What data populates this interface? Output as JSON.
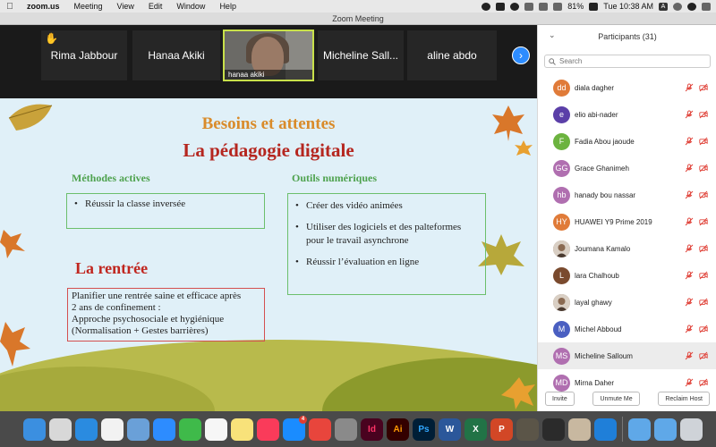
{
  "menubar": {
    "app": "zoom.us",
    "items": [
      "Meeting",
      "View",
      "Edit",
      "Window",
      "Help"
    ],
    "battery": "81%",
    "clock": "Tue 10:38 AM",
    "input_lang": "A"
  },
  "window": {
    "title": "Zoom Meeting"
  },
  "strip": {
    "tiles": [
      {
        "name": "Rima Jabbour",
        "hand_raised": true
      },
      {
        "name": "Hanaa Akiki"
      },
      {
        "name": "hanaa akiki",
        "video": true
      },
      {
        "name": "Micheline Sall..."
      },
      {
        "name": "aline abdo"
      }
    ]
  },
  "slide": {
    "title1": "Besoins et attentes",
    "title2": "La pédagogie digitale",
    "left_heading": "Méthodes actives",
    "left_items": [
      "Réussir la classe inversée"
    ],
    "right_heading": "Outils numériques",
    "right_items": [
      "Créer des vidéo animées",
      "Utiliser des logiciels et des palteformes pour le travail asynchrone",
      "Réussir l’évaluation en ligne"
    ],
    "rentree_title": "La rentrée",
    "rentree_lines": [
      "Planifier une rentrée saine  et efficace après",
      "2 ans de confinement :",
      "Approche psychosociale et hygiénique",
      "(Normalisation + Gestes barrières)"
    ]
  },
  "participants": {
    "header": "Participants (31)",
    "search_placeholder": "Search",
    "list": [
      {
        "initials": "dd",
        "name": "diala dagher",
        "color": "#e07b39"
      },
      {
        "initials": "e",
        "name": "elio abi-nader",
        "color": "#5b3fa8"
      },
      {
        "initials": "F",
        "name": "Fadia Abou jaoude",
        "color": "#6cb33f"
      },
      {
        "initials": "GG",
        "name": "Grace Ghanimeh",
        "color": "#b06fb0"
      },
      {
        "initials": "hb",
        "name": "hanady bou nassar",
        "color": "#b06fb0"
      },
      {
        "initials": "HY",
        "name": "HUAWEI Y9 Prime 2019",
        "color": "#e07b39"
      },
      {
        "initials": "",
        "name": "Joumana Kamalo",
        "photo": true
      },
      {
        "initials": "L",
        "name": "lara Chalhoub",
        "color": "#7a4a2e"
      },
      {
        "initials": "",
        "name": "layal ghawy",
        "photo": true
      },
      {
        "initials": "M",
        "name": "Michel Abboud",
        "color": "#4a5fc1"
      },
      {
        "initials": "MS",
        "name": "Micheline Salloum",
        "color": "#b06fb0"
      },
      {
        "initials": "MD",
        "name": "Mirna Daher",
        "color": "#b06fb0"
      }
    ],
    "buttons": {
      "invite": "Invite",
      "unmute": "Unmute Me",
      "reclaim": "Reclaim Host"
    }
  },
  "dock": {
    "apps": [
      {
        "name": "finder",
        "color": "#3b8fe0",
        "glyph": ""
      },
      {
        "name": "launchpad",
        "color": "#d8d8d8",
        "glyph": ""
      },
      {
        "name": "safari",
        "color": "#2a8be0",
        "glyph": ""
      },
      {
        "name": "chrome",
        "color": "#f2f2f2",
        "glyph": ""
      },
      {
        "name": "preview",
        "color": "#6aa0d8",
        "glyph": ""
      },
      {
        "name": "zoom",
        "color": "#2d8cff",
        "glyph": ""
      },
      {
        "name": "facetime",
        "color": "#3fba4a",
        "glyph": ""
      },
      {
        "name": "photos",
        "color": "#f6f6f6",
        "glyph": ""
      },
      {
        "name": "notes",
        "color": "#f8e27a",
        "glyph": ""
      },
      {
        "name": "music",
        "color": "#fa3b5a",
        "glyph": ""
      },
      {
        "name": "app-store",
        "color": "#1a8cff",
        "glyph": "",
        "badge": "4"
      },
      {
        "name": "anydesk",
        "color": "#e8453c",
        "glyph": ""
      },
      {
        "name": "system-preferences",
        "color": "#8a8a8a",
        "glyph": ""
      },
      {
        "name": "indesign",
        "color": "#49021f",
        "glyph": "Id",
        "text_color": "#ff3366"
      },
      {
        "name": "illustrator",
        "color": "#330000",
        "glyph": "Ai",
        "text_color": "#ff9a00"
      },
      {
        "name": "photoshop",
        "color": "#001e36",
        "glyph": "Ps",
        "text_color": "#31a8ff"
      },
      {
        "name": "word",
        "color": "#2b579a",
        "glyph": "W"
      },
      {
        "name": "excel",
        "color": "#217346",
        "glyph": "X"
      },
      {
        "name": "powerpoint",
        "color": "#d24726",
        "glyph": "P"
      },
      {
        "name": "game",
        "color": "#5b5548",
        "glyph": ""
      },
      {
        "name": "quicktime",
        "color": "#2b2b2b",
        "glyph": ""
      },
      {
        "name": "archive",
        "color": "#c8b8a0",
        "glyph": ""
      },
      {
        "name": "accessibility",
        "color": "#1f7fd9",
        "glyph": ""
      },
      {
        "name": "downloads-folder",
        "color": "#5fa8e8",
        "glyph": "",
        "after_sep": true
      },
      {
        "name": "documents-folder",
        "color": "#5fa8e8",
        "glyph": ""
      },
      {
        "name": "trash",
        "color": "#cfd3d8",
        "glyph": ""
      }
    ]
  }
}
